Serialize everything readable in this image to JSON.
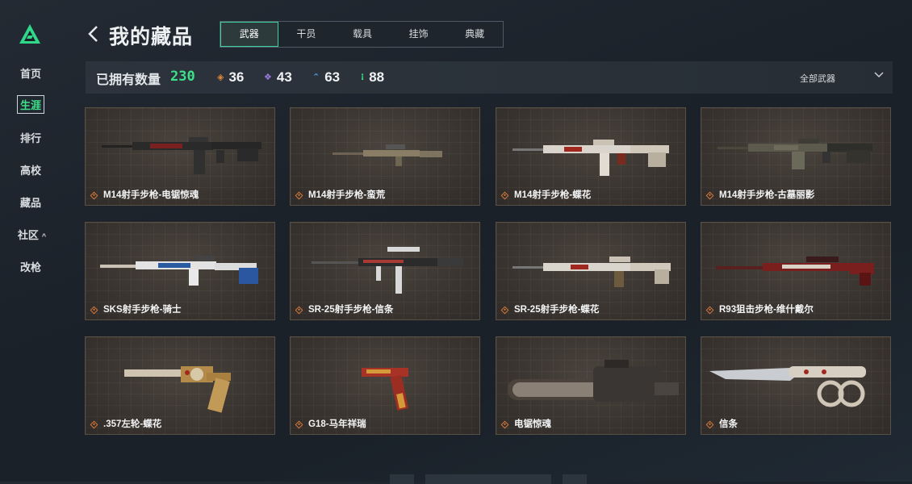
{
  "sidebar": {
    "items": [
      {
        "label": "首页"
      },
      {
        "label": "生涯"
      },
      {
        "label": "排行"
      },
      {
        "label": "高校"
      },
      {
        "label": "藏品"
      },
      {
        "label": "社区"
      },
      {
        "label": "改枪"
      }
    ],
    "active_index": 1
  },
  "header": {
    "title": "我的藏品",
    "tabs": [
      {
        "label": "武器"
      },
      {
        "label": "干员"
      },
      {
        "label": "载具"
      },
      {
        "label": "挂饰"
      },
      {
        "label": "典藏"
      }
    ],
    "active_tab": 0
  },
  "stats": {
    "owned_label": "已拥有数量",
    "owned_count": "230",
    "rarities": [
      {
        "icon": "orange-diamond-icon",
        "color": "#e0883a",
        "count": "36"
      },
      {
        "icon": "purple-diamond-icon",
        "color": "#9b7be0",
        "count": "43"
      },
      {
        "icon": "blue-chevron-icon",
        "color": "#4d9ae0",
        "count": "63"
      },
      {
        "icon": "green-dots-icon",
        "color": "#3ee08a",
        "count": "88"
      }
    ],
    "filter_label": "全部武器"
  },
  "items": [
    {
      "name": "M14射手步枪-电锯惊魂",
      "kind": "rifle-dark"
    },
    {
      "name": "M14射手步枪-蛮荒",
      "kind": "rifle-tan"
    },
    {
      "name": "M14射手步枪-蝶花",
      "kind": "rifle-white"
    },
    {
      "name": "M14射手步枪-古墓丽影",
      "kind": "rifle-olive"
    },
    {
      "name": "SKS射手步枪-骑士",
      "kind": "rifle-knight"
    },
    {
      "name": "SR-25射手步枪-信条",
      "kind": "rifle-creed"
    },
    {
      "name": "SR-25射手步枪-蝶花",
      "kind": "rifle-white2"
    },
    {
      "name": "R93狙击步枪-维什戴尔",
      "kind": "sniper-red"
    },
    {
      "name": ".357左轮-蝶花",
      "kind": "revolver"
    },
    {
      "name": "G18-马年祥瑞",
      "kind": "pistol"
    },
    {
      "name": "电锯惊魂",
      "kind": "chainsaw"
    },
    {
      "name": "信条",
      "kind": "knife"
    }
  ],
  "colors": {
    "accent": "#3ee08a",
    "rarity_orange": "#d2773a",
    "tab_border": "#3fd1a0"
  }
}
